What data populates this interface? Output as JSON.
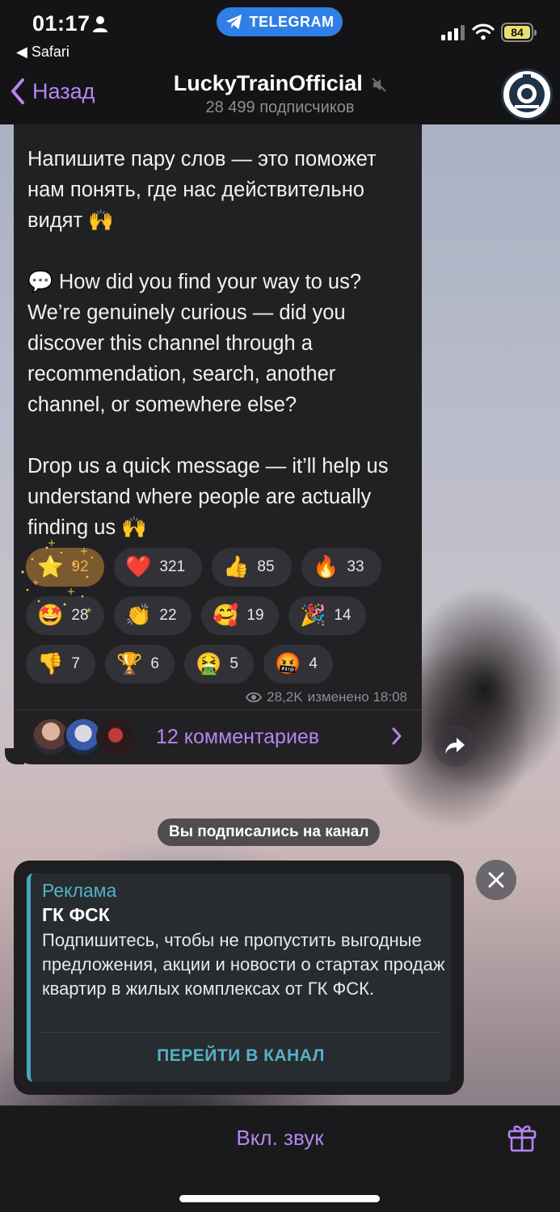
{
  "status_bar": {
    "time": "01:17",
    "back_app": "◀ Safari",
    "pill_label": "TELEGRAM",
    "battery": "84"
  },
  "header": {
    "back_label": "Назад",
    "title": "LuckyTrainOfficial",
    "subtitle": "28 499 подписчиков"
  },
  "message": {
    "text": "Напишите пару слов — это поможет нам понять, где нас действительно видят 🙌\n\n💬 How did you find your way to us? We’re genuinely curious — did you discover this channel through a recommendation, search, another channel, or somewhere else?\n\nDrop us a quick message — it’ll help us understand where people are actually finding us 🙌",
    "reactions_row1": [
      {
        "emoji": "⭐",
        "count": "92",
        "active": true
      },
      {
        "emoji": "❤️",
        "count": "321"
      },
      {
        "emoji": "👍",
        "count": "85"
      },
      {
        "emoji": "🔥",
        "count": "33"
      }
    ],
    "reactions_row2": [
      {
        "emoji": "🤩",
        "count": "28"
      },
      {
        "emoji": "👏",
        "count": "22"
      },
      {
        "emoji": "🥰",
        "count": "19"
      },
      {
        "emoji": "🎉",
        "count": "14"
      }
    ],
    "reactions_row3": [
      {
        "emoji": "👎",
        "count": "7"
      },
      {
        "emoji": "🏆",
        "count": "6"
      },
      {
        "emoji": "🤮",
        "count": "5"
      },
      {
        "emoji": "🤬",
        "count": "4"
      }
    ],
    "views": "28,2K",
    "edited": "изменено 18:08",
    "comments_label": "12 комментариев"
  },
  "service_message": "Вы подписались на канал",
  "ad": {
    "label": "Реклама",
    "title": "ГК ФСК",
    "body": "Подпишитесь, чтобы не пропустить выгодные предложения, акции и новости о стартах продаж квартир в жилых комплексах от ГК ФСК.",
    "button": "ПЕРЕЙТИ В КАНАЛ"
  },
  "bottom_bar": {
    "unmute_label": "Вкл. звук"
  },
  "colors": {
    "accent": "#b585f0",
    "ad_accent": "#56b0c8",
    "telegram_pill": "#2f7fe6",
    "bubble": "#212124"
  }
}
